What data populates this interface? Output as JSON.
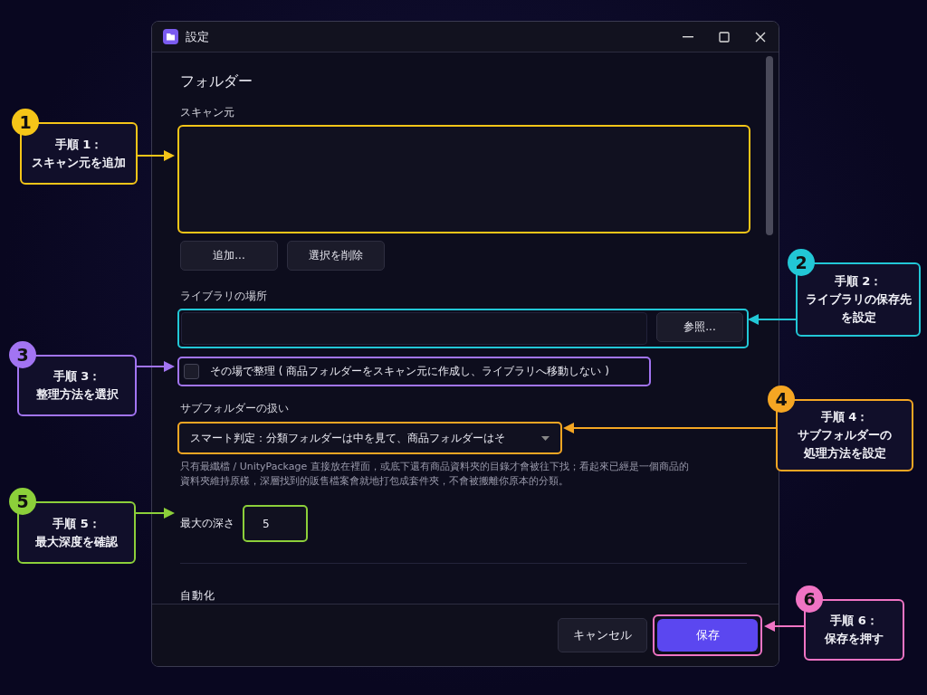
{
  "window": {
    "title": "設定"
  },
  "section_title": "フォルダー",
  "scan_sources": {
    "label": "スキャン元",
    "buttons": [
      "追加...",
      "選択を削除"
    ]
  },
  "library": {
    "label": "ライブラリの場所",
    "button": "参照..."
  },
  "in_place": {
    "label": "その場で整理 ( 商品フォルダーをスキャン元に作成し、ライブラリへ移動しない )",
    "checked": false
  },
  "subfolder": {
    "label": "サブフォルダーの扱い",
    "value": "スマート判定：分類フォルダーは中を見て、商品フォルダーはそ",
    "help": "只有最纖檔 / UnityPackage 直接放在裡面，或底下還有商品資料夾的目錄才會被往下找；看起來已經是一個商品的資料夾維持原樣，深層找到的販售檔案會就地打包成套件夾，不會被搬離你原本的分類。"
  },
  "max_depth": {
    "label": "最大の深さ",
    "value": "5"
  },
  "next_section": "自動化",
  "footer_buttons": [
    {
      "label": "キャンセル",
      "kind": "secondary"
    },
    {
      "label": "保存",
      "kind": "primary"
    }
  ],
  "callouts": [
    {
      "number": "1",
      "lines": [
        "手順 1：",
        "スキャン元を追加"
      ],
      "color": "#f5c518"
    },
    {
      "number": "2",
      "lines": [
        "手順 2：",
        "ライブラリの保存先",
        "を設定"
      ],
      "color": "#22c7d6"
    },
    {
      "number": "3",
      "lines": [
        "手順 3：",
        "整理方法を選択"
      ],
      "color": "#a274f2"
    },
    {
      "number": "4",
      "lines": [
        "手順 4：",
        "サブフォルダーの",
        "処理方法を設定"
      ],
      "color": "#f5a623"
    },
    {
      "number": "5",
      "lines": [
        "手順 5：",
        "最大深度を確認"
      ],
      "color": "#8ccf3a"
    },
    {
      "number": "6",
      "lines": [
        "手順 6：",
        "保存を押す"
      ],
      "color": "#f074c4"
    }
  ]
}
